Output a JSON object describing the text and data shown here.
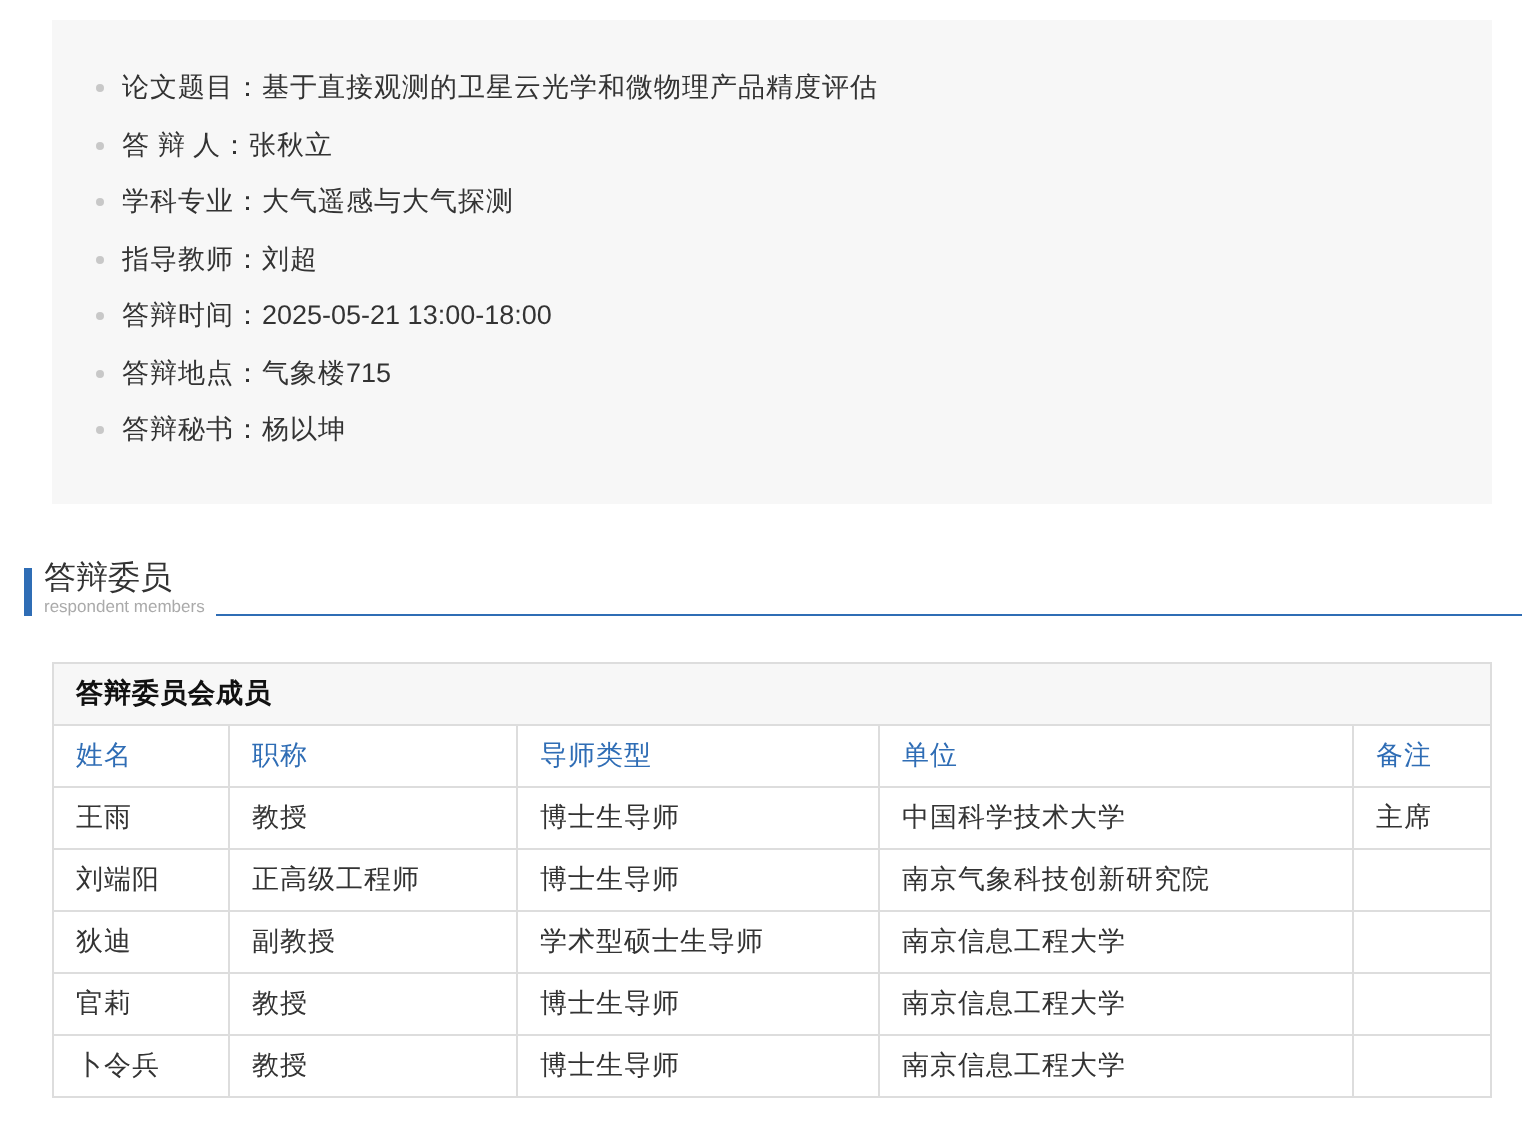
{
  "info": [
    {
      "label": "论文题目：",
      "value": "基于直接观测的卫星云光学和微物理产品精度评估"
    },
    {
      "label": "答 辩 人：",
      "value": "张秋立"
    },
    {
      "label": "学科专业：",
      "value": "大气遥感与大气探测"
    },
    {
      "label": "指导教师：",
      "value": "刘超"
    },
    {
      "label": "答辩时间：",
      "value": "2025-05-21 13:00-18:00"
    },
    {
      "label": "答辩地点：",
      "value": "气象楼715"
    },
    {
      "label": "答辩秘书：",
      "value": "杨以坤"
    }
  ],
  "section": {
    "title": "答辩委员",
    "subtitle": "respondent members"
  },
  "table": {
    "caption": "答辩委员会成员",
    "columns": [
      "姓名",
      "职称",
      "导师类型",
      "单位",
      "备注"
    ],
    "rows": [
      [
        "王雨",
        "教授",
        "博士生导师",
        "中国科学技术大学",
        "主席"
      ],
      [
        "刘端阳",
        "正高级工程师",
        "博士生导师",
        "南京气象科技创新研究院"
      ],
      [
        "狄迪",
        "副教授",
        "学术型硕士生导师",
        "南京信息工程大学"
      ],
      [
        "官莉",
        "教授",
        "博士生导师",
        "南京信息工程大学"
      ],
      [
        "卜令兵",
        "教授",
        "博士生导师",
        "南京信息工程大学"
      ]
    ]
  }
}
